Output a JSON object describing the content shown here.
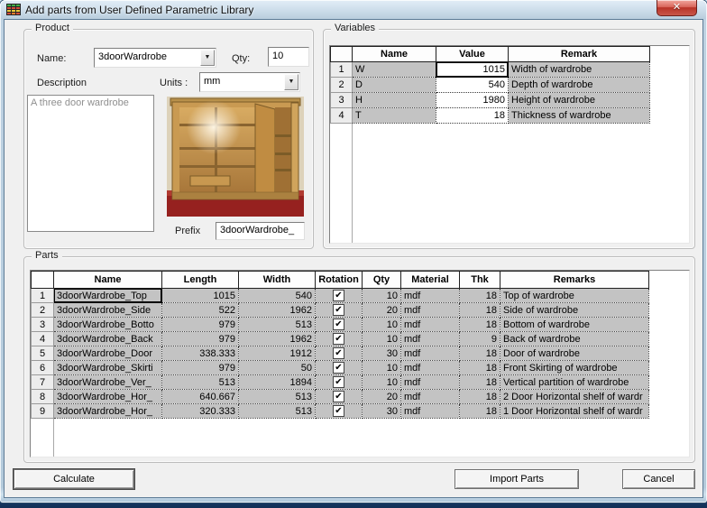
{
  "window": {
    "title": "Add parts from User Defined Parametric Library",
    "close_glyph": "✕"
  },
  "product": {
    "legend": "Product",
    "name_label": "Name:",
    "name_value": "3doorWardrobe",
    "qty_label": "Qty:",
    "qty_value": "10",
    "description_label": "Description",
    "description_value": "A three door wardrobe",
    "units_label": "Units :",
    "units_value": "mm",
    "prefix_label": "Prefix",
    "prefix_value": "3doorWardrobe_"
  },
  "variables": {
    "legend": "Variables",
    "columns": [
      "Name",
      "Value",
      "Remark"
    ],
    "rows": [
      {
        "num": "1",
        "name": "W",
        "value": "1015",
        "remark": "Width of wardrobe"
      },
      {
        "num": "2",
        "name": "D",
        "value": "540",
        "remark": "Depth of wardrobe"
      },
      {
        "num": "3",
        "name": "H",
        "value": "1980",
        "remark": "Height of wardrobe"
      },
      {
        "num": "4",
        "name": "T",
        "value": "18",
        "remark": "Thickness of wardrobe"
      }
    ]
  },
  "parts": {
    "legend": "Parts",
    "columns": [
      "Name",
      "Length",
      "Width",
      "Rotation",
      "Qty",
      "Material",
      "Thk",
      "Remarks"
    ],
    "rows": [
      {
        "num": "1",
        "name": "3doorWardrobe_Top",
        "length": "1015",
        "width": "540",
        "rotation": true,
        "qty": "10",
        "material": "mdf",
        "thk": "18",
        "remarks": "Top  of wardrobe"
      },
      {
        "num": "2",
        "name": "3doorWardrobe_Side",
        "length": "522",
        "width": "1962",
        "rotation": true,
        "qty": "20",
        "material": "mdf",
        "thk": "18",
        "remarks": "Side of wardrobe"
      },
      {
        "num": "3",
        "name": "3doorWardrobe_Botto",
        "length": "979",
        "width": "513",
        "rotation": true,
        "qty": "10",
        "material": "mdf",
        "thk": "18",
        "remarks": "Bottom of wardrobe"
      },
      {
        "num": "4",
        "name": "3doorWardrobe_Back",
        "length": "979",
        "width": "1962",
        "rotation": true,
        "qty": "10",
        "material": "mdf",
        "thk": "9",
        "remarks": "Back of wardrobe"
      },
      {
        "num": "5",
        "name": "3doorWardrobe_Door",
        "length": "338.333",
        "width": "1912",
        "rotation": true,
        "qty": "30",
        "material": "mdf",
        "thk": "18",
        "remarks": "Door of wardrobe"
      },
      {
        "num": "6",
        "name": "3doorWardrobe_Skirti",
        "length": "979",
        "width": "50",
        "rotation": true,
        "qty": "10",
        "material": "mdf",
        "thk": "18",
        "remarks": "Front Skirting of wardrobe"
      },
      {
        "num": "7",
        "name": "3doorWardrobe_Ver_",
        "length": "513",
        "width": "1894",
        "rotation": true,
        "qty": "10",
        "material": "mdf",
        "thk": "18",
        "remarks": "Vertical partition of wardrobe"
      },
      {
        "num": "8",
        "name": "3doorWardrobe_Hor_",
        "length": "640.667",
        "width": "513",
        "rotation": true,
        "qty": "20",
        "material": "mdf",
        "thk": "18",
        "remarks": "2 Door Horizontal shelf of wardr"
      },
      {
        "num": "9",
        "name": "3doorWardrobe_Hor_",
        "length": "320.333",
        "width": "513",
        "rotation": true,
        "qty": "30",
        "material": "mdf",
        "thk": "18",
        "remarks": "1 Door Horizontal shelf of wardr"
      }
    ]
  },
  "buttons": {
    "calculate": "Calculate",
    "import_parts": "Import Parts",
    "cancel": "Cancel"
  },
  "colors": {
    "dialog_bg": "#f0f0f0",
    "grid_gray_cell": "#c3c3c3",
    "titlebar_glass": "#c4d8e8",
    "close_red": "#b83327"
  }
}
